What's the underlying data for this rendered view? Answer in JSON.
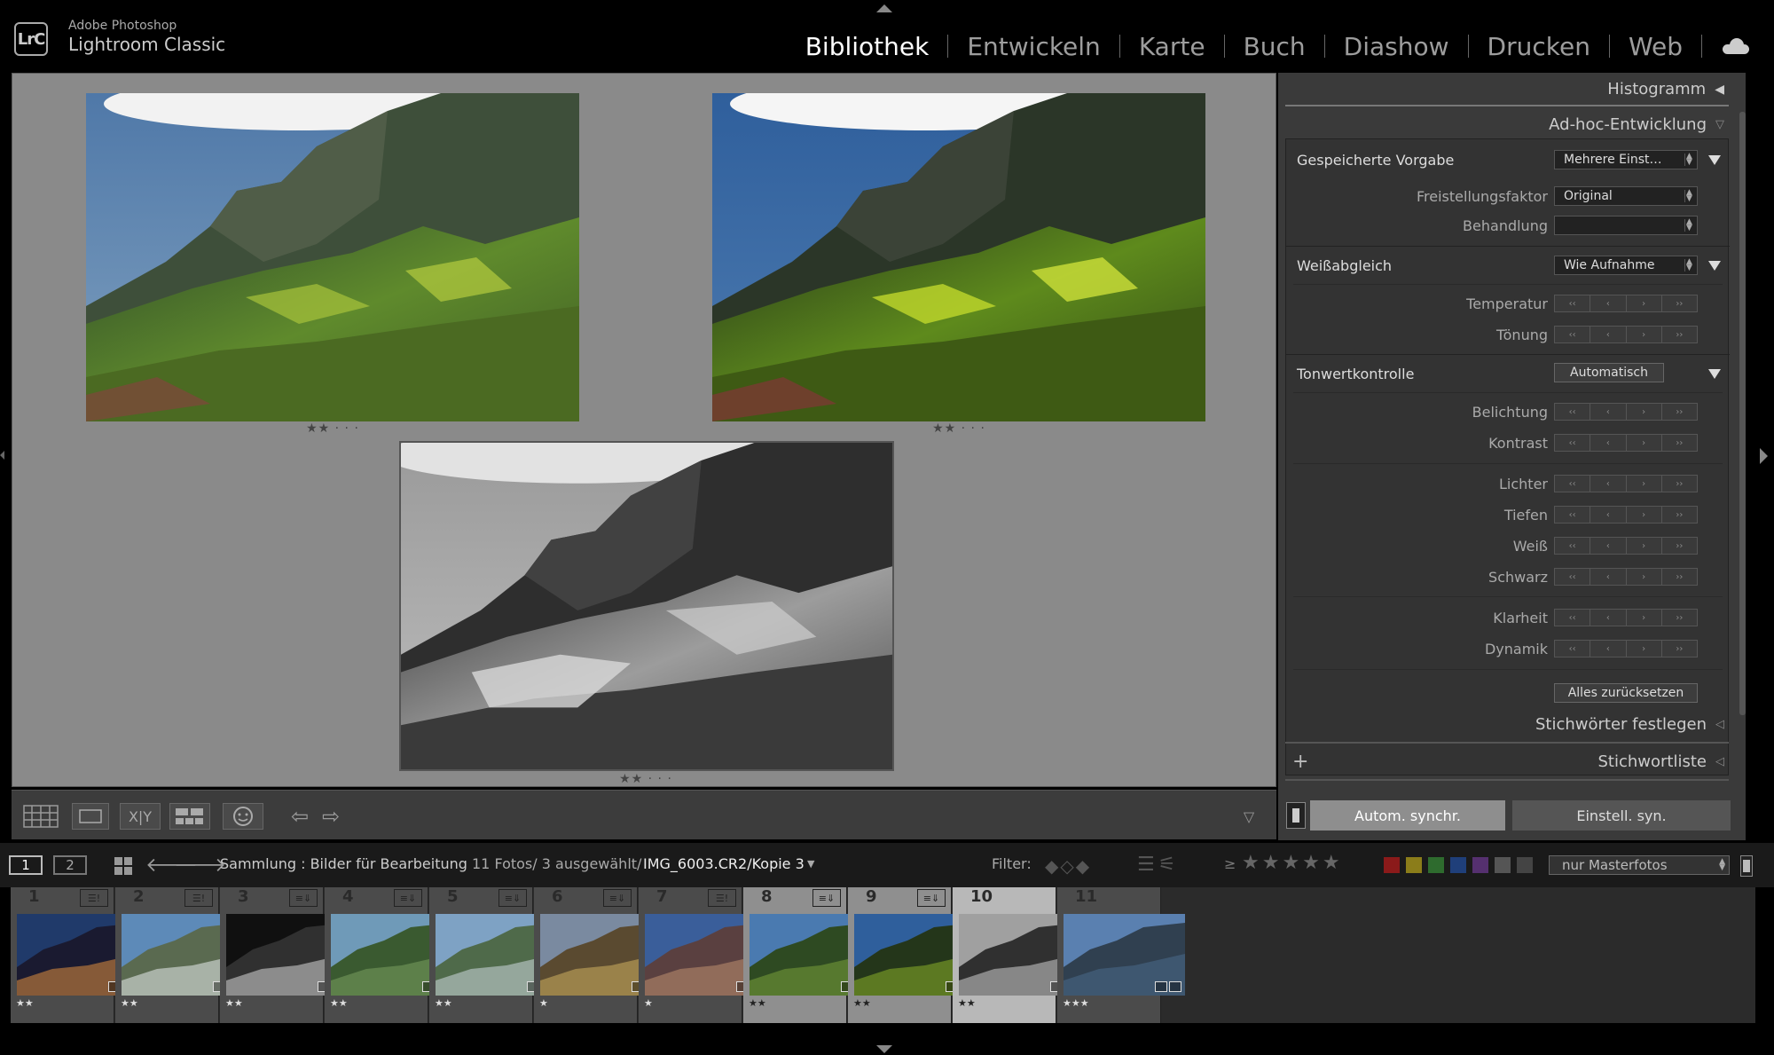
{
  "app": {
    "logo": "LrC",
    "brand_line1": "Adobe Photoshop",
    "brand_line2": "Lightroom Classic"
  },
  "modules": [
    {
      "label": "Bibliothek",
      "active": true
    },
    {
      "label": "Entwickeln"
    },
    {
      "label": "Karte"
    },
    {
      "label": "Buch"
    },
    {
      "label": "Diashow"
    },
    {
      "label": "Drucken"
    },
    {
      "label": "Web"
    }
  ],
  "survey": {
    "photos": [
      {
        "stars": "★★ · · ·"
      },
      {
        "stars": "★★ · · ·"
      },
      {
        "stars": "★★ · · ·"
      }
    ]
  },
  "right_panel": {
    "histogram": "Histogramm",
    "adhoc": "Ad-hoc-Entwicklung",
    "saved_preset_label": "Gespeicherte Vorgabe",
    "saved_preset_value": "Mehrere Einst…",
    "crop_label": "Freistellungsfaktor",
    "crop_value": "Original",
    "treatment_label": "Behandlung",
    "treatment_value": "",
    "wb_label": "Weißabgleich",
    "wb_value": "Wie Aufnahme",
    "temp_label": "Temperatur",
    "tint_label": "Tönung",
    "tone_label": "Tonwertkontrolle",
    "tone_auto": "Automatisch",
    "exposure": "Belichtung",
    "contrast": "Kontrast",
    "highlights": "Lichter",
    "shadows": "Tiefen",
    "whites": "Weiß",
    "blacks": "Schwarz",
    "clarity": "Klarheit",
    "vibrance": "Dynamik",
    "reset_all": "Alles zurücksetzen",
    "keywording": "Stichwörter festlegen",
    "keyword_list": "Stichwortliste",
    "plus": "+"
  },
  "sync": {
    "auto_sync": "Autom. synchr.",
    "sync_settings": "Einstell. syn."
  },
  "filmstrip_header": {
    "monitor1": "1",
    "monitor2": "2",
    "source": "Sammlung : Bilder für Bearbeitung",
    "count": "11 Fotos/ 3 ausgewählt/",
    "filename": "IMG_6003.CR2/Kopie 3",
    "filter_label": "Filter:",
    "rating_op": "≥",
    "master_filter": "nur Masterfotos",
    "label_colors": [
      "#8b1a1a",
      "#8b7d1a",
      "#2e6b2e",
      "#1f3f7a",
      "#55306f",
      "#555555",
      "#444444"
    ]
  },
  "filmstrip": [
    {
      "num": "1",
      "stars": "★★"
    },
    {
      "num": "2",
      "stars": "★★"
    },
    {
      "num": "3",
      "stars": "★★"
    },
    {
      "num": "4",
      "stars": "★★"
    },
    {
      "num": "5",
      "stars": "★★"
    },
    {
      "num": "6",
      "stars": "★"
    },
    {
      "num": "7",
      "stars": "★"
    },
    {
      "num": "8",
      "stars": "★★"
    },
    {
      "num": "9",
      "stars": "★★"
    },
    {
      "num": "10",
      "stars": "★★"
    },
    {
      "num": "11",
      "stars": "★★★"
    }
  ]
}
